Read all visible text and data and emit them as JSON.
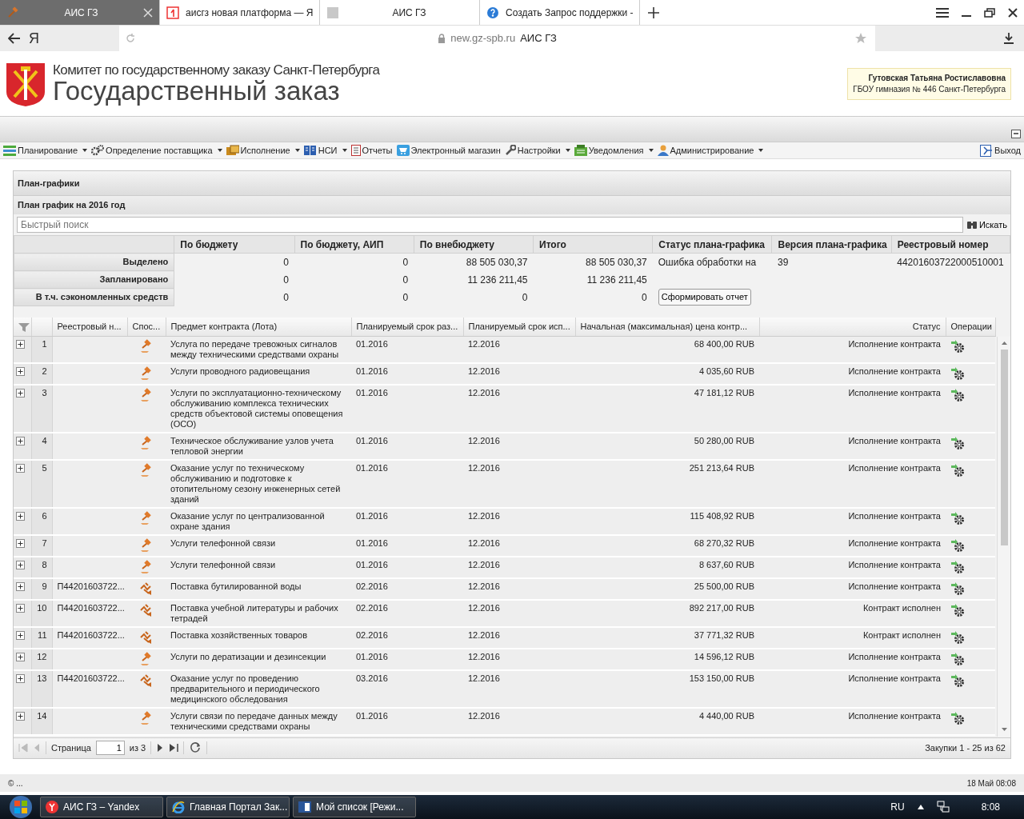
{
  "browser": {
    "tabs": [
      {
        "title": "АИС ГЗ",
        "selected": true
      },
      {
        "title": "аисгз новая платформа — Я",
        "selected": false
      },
      {
        "title": "АИС ГЗ",
        "selected": false
      },
      {
        "title": "Создать Запрос поддержки -",
        "selected": false
      }
    ],
    "logo": "Я",
    "host": "new.gz-spb.ru",
    "page_title": "АИС ГЗ"
  },
  "header": {
    "org": "Комитет по государственному заказу Санкт-Петербурга",
    "title": "Государственный заказ",
    "user": {
      "name": "Гутовская Татьяна Ростиславовна",
      "org": "ГБОУ гимназия № 446 Санкт-Петербурга"
    }
  },
  "menu": {
    "items": [
      {
        "label": "Планирование",
        "dropdown": true
      },
      {
        "label": "Определение поставщика",
        "dropdown": true
      },
      {
        "label": "Исполнение",
        "dropdown": true
      },
      {
        "label": "НСИ",
        "dropdown": true
      },
      {
        "label": "Отчеты",
        "dropdown": false
      },
      {
        "label": "Электронный магазин",
        "dropdown": false
      },
      {
        "label": "Настройки",
        "dropdown": true
      },
      {
        "label": "Уведомления",
        "dropdown": true
      },
      {
        "label": "Администрирование",
        "dropdown": true
      }
    ],
    "exit": "Выход"
  },
  "panel": {
    "title": "План-графики",
    "subtitle": "План график на 2016 год",
    "search": {
      "placeholder": "Быстрый поиск",
      "button": "Искать"
    }
  },
  "summary": {
    "columns": [
      "По бюджету",
      "По бюджету, АИП",
      "По внебюджету",
      "Итого",
      "Статус плана-графика",
      "Версия плана-графика",
      "Реестровый номер"
    ],
    "rows": [
      {
        "label": "Выделено",
        "cells": [
          "0",
          "0",
          "88 505 030,37",
          "88 505 030,37",
          "Ошибка обработки на",
          "39",
          "44201603722000510001"
        ]
      },
      {
        "label": "Запланировано",
        "cells": [
          "0",
          "0",
          "11 236 211,45",
          "11 236 211,45"
        ]
      },
      {
        "label": "В т.ч. сэкономленных средств",
        "cells": [
          "0",
          "0",
          "0",
          "0"
        ]
      }
    ],
    "report_button": "Сформировать отчет"
  },
  "grid": {
    "columns": [
      "Реестровый н...",
      "Спос...",
      "Предмет контракта (Лота)",
      "Планируемый срок раз...",
      "Планируемый срок исп...",
      "Начальная (максимальная) цена контр...",
      "Статус",
      "Операции"
    ],
    "rows": [
      {
        "num": "1",
        "reg": "",
        "kind": "gavel",
        "subject": "Услуга по передаче тревожных сигналов между техническими средствами охраны",
        "start": "01.2016",
        "end": "12.2016",
        "price": "68 400,00 RUB",
        "status": "Исполнение контракта"
      },
      {
        "num": "2",
        "reg": "",
        "kind": "gavel",
        "subject": "Услуги проводного радиовещания",
        "start": "01.2016",
        "end": "12.2016",
        "price": "4 035,60 RUB",
        "status": "Исполнение контракта"
      },
      {
        "num": "3",
        "reg": "",
        "kind": "gavel",
        "subject": "Услуги по эксплуатационно-техническому обслуживанию комплекса технических средств объектовой системы оповещения (ОСО)",
        "start": "01.2016",
        "end": "12.2016",
        "price": "47 181,12 RUB",
        "status": "Исполнение контракта"
      },
      {
        "num": "4",
        "reg": "",
        "kind": "gavel",
        "subject": "Техническое обслуживание узлов учета тепловой энергии",
        "start": "01.2016",
        "end": "12.2016",
        "price": "50 280,00 RUB",
        "status": "Исполнение контракта"
      },
      {
        "num": "5",
        "reg": "",
        "kind": "gavel",
        "subject": "Оказание услуг по техническому обслуживанию и подготовке к отопительному сезону инженерных сетей зданий",
        "start": "01.2016",
        "end": "12.2016",
        "price": "251 213,64 RUB",
        "status": "Исполнение контракта"
      },
      {
        "num": "6",
        "reg": "",
        "kind": "gavel",
        "subject": "Оказание услуг по централизованной охране здания",
        "start": "01.2016",
        "end": "12.2016",
        "price": "115 408,92 RUB",
        "status": "Исполнение контракта"
      },
      {
        "num": "7",
        "reg": "",
        "kind": "gavel",
        "subject": "Услуги телефонной связи",
        "start": "01.2016",
        "end": "12.2016",
        "price": "68 270,32 RUB",
        "status": "Исполнение контракта"
      },
      {
        "num": "8",
        "reg": "",
        "kind": "gavel",
        "subject": "Услуги телефонной связи",
        "start": "01.2016",
        "end": "12.2016",
        "price": "8 637,60 RUB",
        "status": "Исполнение контракта"
      },
      {
        "num": "9",
        "reg": "П44201603722...",
        "kind": "zigzag",
        "subject": "Поставка бутилированной воды",
        "start": "02.2016",
        "end": "12.2016",
        "price": "25 500,00 RUB",
        "status": "Исполнение контракта"
      },
      {
        "num": "10",
        "reg": "П44201603722...",
        "kind": "zigzag",
        "subject": "Поставка учебной литературы и рабочих тетрадей",
        "start": "02.2016",
        "end": "12.2016",
        "price": "892 217,00 RUB",
        "status": "Контракт исполнен"
      },
      {
        "num": "11",
        "reg": "П44201603722...",
        "kind": "zigzag",
        "subject": "Поставка хозяйственных товаров",
        "start": "02.2016",
        "end": "12.2016",
        "price": "37 771,32 RUB",
        "status": "Контракт исполнен"
      },
      {
        "num": "12",
        "reg": "",
        "kind": "gavel",
        "subject": "Услуги по дератизации и дезинсекции",
        "start": "01.2016",
        "end": "12.2016",
        "price": "14 596,12 RUB",
        "status": "Исполнение контракта"
      },
      {
        "num": "13",
        "reg": "П44201603722...",
        "kind": "zigzag",
        "subject": "Оказание услуг по проведению предварительного и периодического медицинского обследования",
        "start": "03.2016",
        "end": "12.2016",
        "price": "153 150,00 RUB",
        "status": "Исполнение контракта"
      },
      {
        "num": "14",
        "reg": "",
        "kind": "gavel",
        "subject": "Услуги связи по передаче данных между техническими средствами охраны",
        "start": "01.2016",
        "end": "12.2016",
        "price": "4 440,00 RUB",
        "status": "Исполнение контракта"
      }
    ]
  },
  "pager": {
    "label": "Страница",
    "page": "1",
    "of": "из 3",
    "summary": "Закупки 1 - 25 из 62"
  },
  "footer": {
    "copyright": "© ...",
    "date": "18 Май 08:08"
  },
  "taskbar": {
    "items": [
      "АИС ГЗ – Yandex",
      "Главная Портал Зак...",
      "Мой список [Режи..."
    ],
    "lang": "RU",
    "time": "8:08"
  }
}
